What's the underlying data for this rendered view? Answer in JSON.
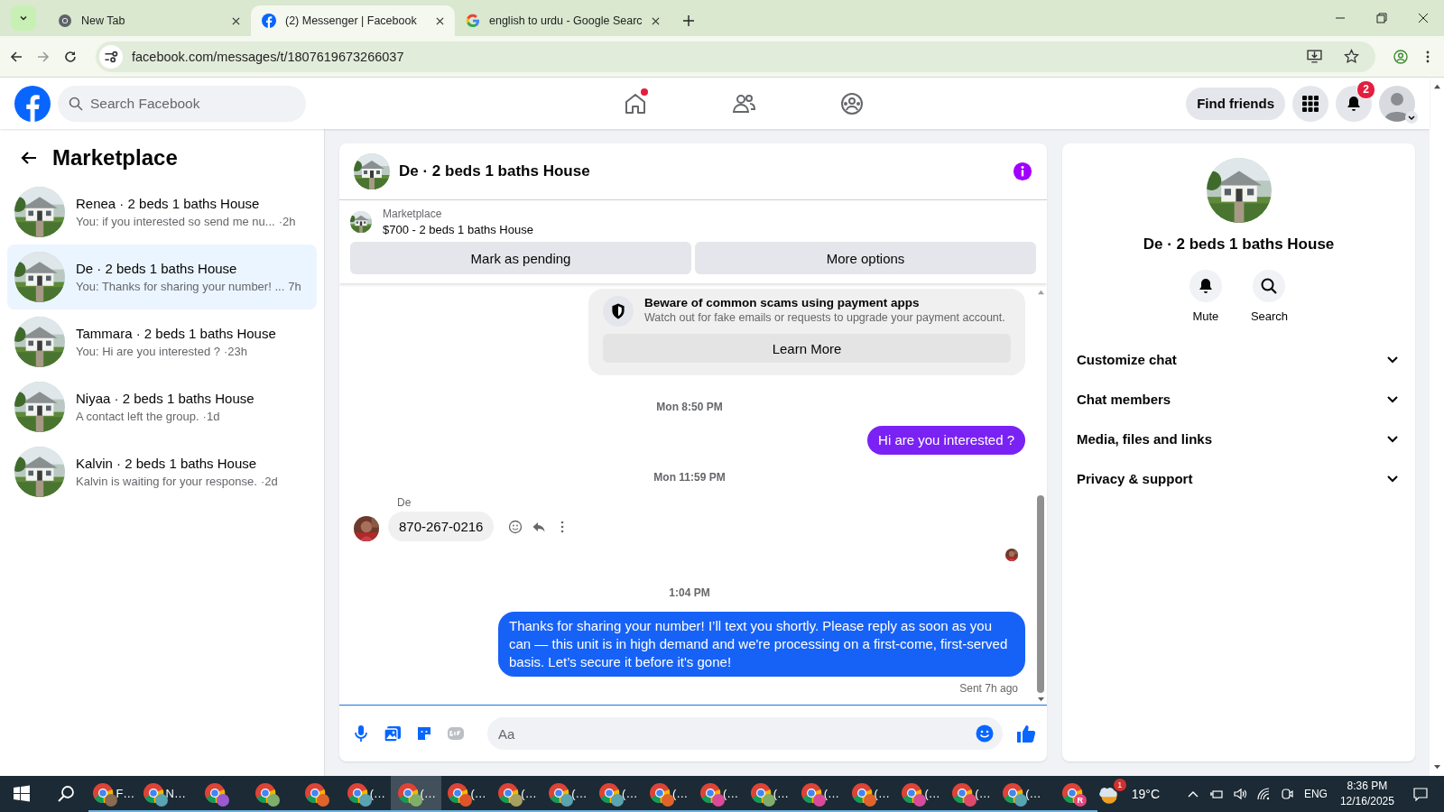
{
  "browser": {
    "tabs": [
      {
        "title": "New Tab",
        "kind": "chrome",
        "selected": false
      },
      {
        "title": "(2) Messenger | Facebook",
        "kind": "facebook",
        "selected": true
      },
      {
        "title": "english to urdu - Google Searc",
        "kind": "google",
        "selected": false
      }
    ],
    "url": "facebook.com/messages/t/1807619673266037"
  },
  "header": {
    "search_placeholder": "Search Facebook",
    "nav": [
      {
        "kind": "home",
        "dot": true
      },
      {
        "kind": "friends",
        "dot": false
      },
      {
        "kind": "groups",
        "dot": false
      }
    ],
    "find_friends": "Find friends",
    "notification_count": "2"
  },
  "sidebar": {
    "title": "Marketplace",
    "conversations": [
      {
        "name": "Renea · 2 beds 1 baths House",
        "preview": "You: if you interested so send me nu...",
        "time": "·2h",
        "selected": false
      },
      {
        "name": "De · 2 beds 1 baths House",
        "preview": "You: Thanks for sharing your number! ...",
        "time": "7h",
        "selected": true
      },
      {
        "name": "Tammara · 2 beds 1 baths House",
        "preview": "You: Hi are you interested ?",
        "time": "·23h",
        "selected": false
      },
      {
        "name": "Niyaa · 2 beds 1 baths House",
        "preview": "A contact left the group.",
        "time": "·1d",
        "selected": false
      },
      {
        "name": "Kalvin · 2 beds 1 baths House",
        "preview": "Kalvin is waiting for your response.",
        "time": "·2d",
        "selected": false
      }
    ]
  },
  "chat": {
    "title": "De · 2 beds 1 baths House",
    "listing": {
      "label": "Marketplace",
      "title": "$700 - 2 beds 1 baths House",
      "buttons": [
        "Mark as pending",
        "More options"
      ]
    },
    "notice": {
      "title": "Beware of common scams using payment apps",
      "body": "Watch out for fake emails or requests to upgrade your payment account.",
      "button": "Learn More"
    },
    "messages": [
      {
        "kind": "time",
        "text": "Mon 8:50 PM"
      },
      {
        "kind": "sent",
        "text": "Hi are you interested ?",
        "color": "#7a22f4"
      },
      {
        "kind": "time",
        "text": "Mon 11:59 PM"
      },
      {
        "kind": "received",
        "sender": "De",
        "text": "870-267-0216"
      },
      {
        "kind": "seen"
      },
      {
        "kind": "time",
        "text": "1:04 PM"
      },
      {
        "kind": "sent",
        "text": "Thanks for sharing your number! I’ll text you shortly. Please reply as soon as you can — this unit is in high demand and we're processing on a first-come, first-served basis. Let’s secure it before it's gone!",
        "color": "#1762f6"
      },
      {
        "kind": "status",
        "text": "Sent 7h ago"
      }
    ],
    "composer_placeholder": "Aa"
  },
  "details": {
    "title": "De · 2 beds 1 baths House",
    "actions": [
      {
        "kind": "mute",
        "label": "Mute"
      },
      {
        "kind": "search",
        "label": "Search"
      }
    ],
    "sections": [
      {
        "label": "Customize chat",
        "expanded": false
      },
      {
        "label": "Chat members",
        "expanded": false
      },
      {
        "label": "Media, files and links",
        "expanded": false
      },
      {
        "label": "Privacy & support",
        "expanded": false
      }
    ]
  },
  "taskbar": {
    "apps": [
      {
        "label": "F…",
        "color": "#8a6a50",
        "selected": false
      },
      {
        "label": "N…",
        "color": "#5aa3b0",
        "selected": false
      },
      {
        "color": "#9b59d0",
        "selected": false
      },
      {
        "color": "#7fae6a",
        "selected": false
      },
      {
        "color": "#e0642a",
        "selected": false
      },
      {
        "label": "(…",
        "color": "#5aa3b0",
        "selected": false
      },
      {
        "label": "(…",
        "color": "#7fae6a",
        "selected": true
      },
      {
        "label": "(…",
        "color": "#e0542a",
        "selected": false
      },
      {
        "label": "(…",
        "color": "#a8a060",
        "selected": false
      },
      {
        "label": "(…",
        "color": "#5aa3b0",
        "selected": false
      },
      {
        "label": "(…",
        "color": "#5aa3b0",
        "selected": false
      },
      {
        "label": "(…",
        "color": "#e0642a",
        "selected": false
      },
      {
        "label": "(…",
        "color": "#d94a9a",
        "selected": false
      },
      {
        "label": "(…",
        "color": "#7fae6a",
        "selected": false
      },
      {
        "label": "(…",
        "color": "#d94a9a",
        "selected": false
      },
      {
        "label": "(…",
        "color": "#e0642a",
        "selected": false
      },
      {
        "label": "(…",
        "color": "#d94a9a",
        "selected": false
      },
      {
        "label": "(…",
        "color": "#e04a6a",
        "selected": false
      },
      {
        "label": "(…",
        "color": "#5aa3b0",
        "selected": false
      },
      {
        "letter": "R",
        "color": "#e0467a",
        "selected": false
      }
    ],
    "weather_badge": "1",
    "temperature": "19°C",
    "language": "ENG",
    "time": "8:36 PM",
    "date": "12/16/2025"
  }
}
